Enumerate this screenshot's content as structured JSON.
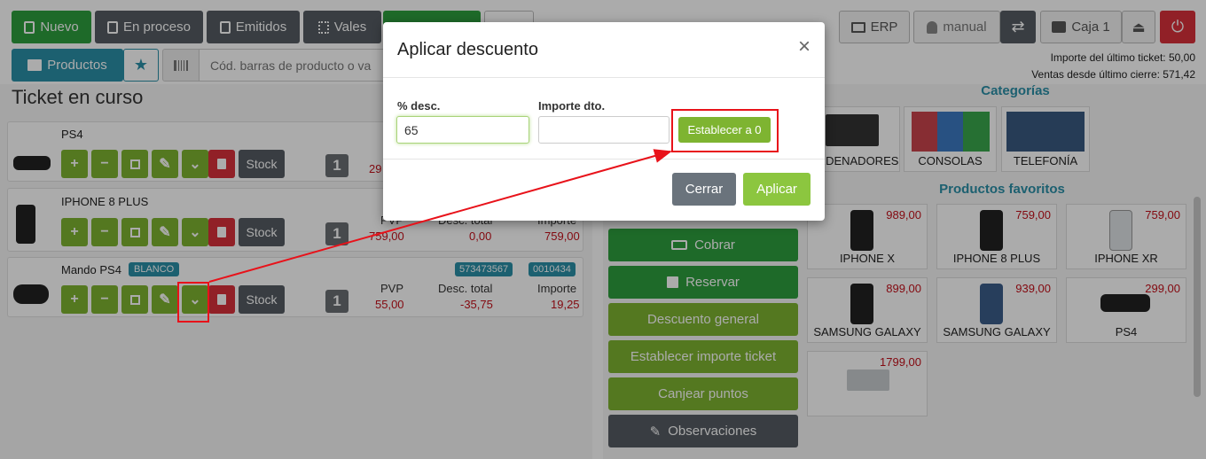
{
  "toolbar": {
    "nuevo": "Nuevo",
    "en_proceso": "En proceso",
    "emitidos": "Emitidos",
    "vales": "Vales",
    "erp": "ERP",
    "manual": "manual",
    "caja": "Caja 1"
  },
  "search": {
    "productos_label": "Productos",
    "barcode_placeholder": "Cód. barras de producto o va"
  },
  "stats": {
    "last_ticket": "Importe del último ticket: 50,00",
    "sales_since_close": "Ventas desde último cierre: 571,42"
  },
  "ticket": {
    "title": "Ticket en curso",
    "stock_label": "Stock",
    "col_pvp": "PVP",
    "col_desc": "Desc. total",
    "col_importe": "Importe",
    "lines": [
      {
        "name": "PS4",
        "qty": "1",
        "pvp_partial": "29"
      },
      {
        "name": "IPHONE 8 PLUS",
        "qty": "1",
        "pvp": "759,00",
        "desc": "0,00",
        "importe": "759,00"
      },
      {
        "name": "Mando PS4",
        "tag": "BLANCO",
        "code1": "573473567",
        "code2": "0010434",
        "qty": "1",
        "pvp": "55,00",
        "desc": "-35,75",
        "importe": "19,25"
      }
    ]
  },
  "actions": {
    "cobrar": "Cobrar",
    "reservar": "Reservar",
    "descuento_general": "Descuento general",
    "establecer_importe": "Establecer importe ticket",
    "canjear_puntos": "Canjear puntos",
    "observaciones": "Observaciones"
  },
  "categories": {
    "title": "Categorías",
    "items": [
      "ORDENADORES",
      "CONSOLAS",
      "TELEFONÍA"
    ]
  },
  "favorites": {
    "title": "Productos favoritos",
    "items": [
      {
        "name": "IPHONE X",
        "price": "989,00"
      },
      {
        "name": "IPHONE 8 PLUS",
        "price": "759,00"
      },
      {
        "name": "IPHONE XR",
        "price": "759,00"
      },
      {
        "name": "SAMSUNG GALAXY",
        "price": "899,00"
      },
      {
        "name": "SAMSUNG GALAXY",
        "price": "939,00"
      },
      {
        "name": "PS4",
        "price": "299,00"
      },
      {
        "name": "",
        "price": "1799,00"
      }
    ]
  },
  "modal": {
    "title": "Aplicar descuento",
    "close_glyph": "×",
    "pct_label": "% desc.",
    "pct_value": "65",
    "importe_label": "Importe dto.",
    "importe_value": "",
    "reset_button": "Establecer a 0",
    "cerrar": "Cerrar",
    "aplicar": "Aplicar"
  },
  "colors": {
    "green_dark": "#2e9e3e",
    "green_light": "#7eb431",
    "red": "#d9313b",
    "grey": "#555c63",
    "teal": "#2b8fa8",
    "annotation_red": "#e8121a"
  }
}
